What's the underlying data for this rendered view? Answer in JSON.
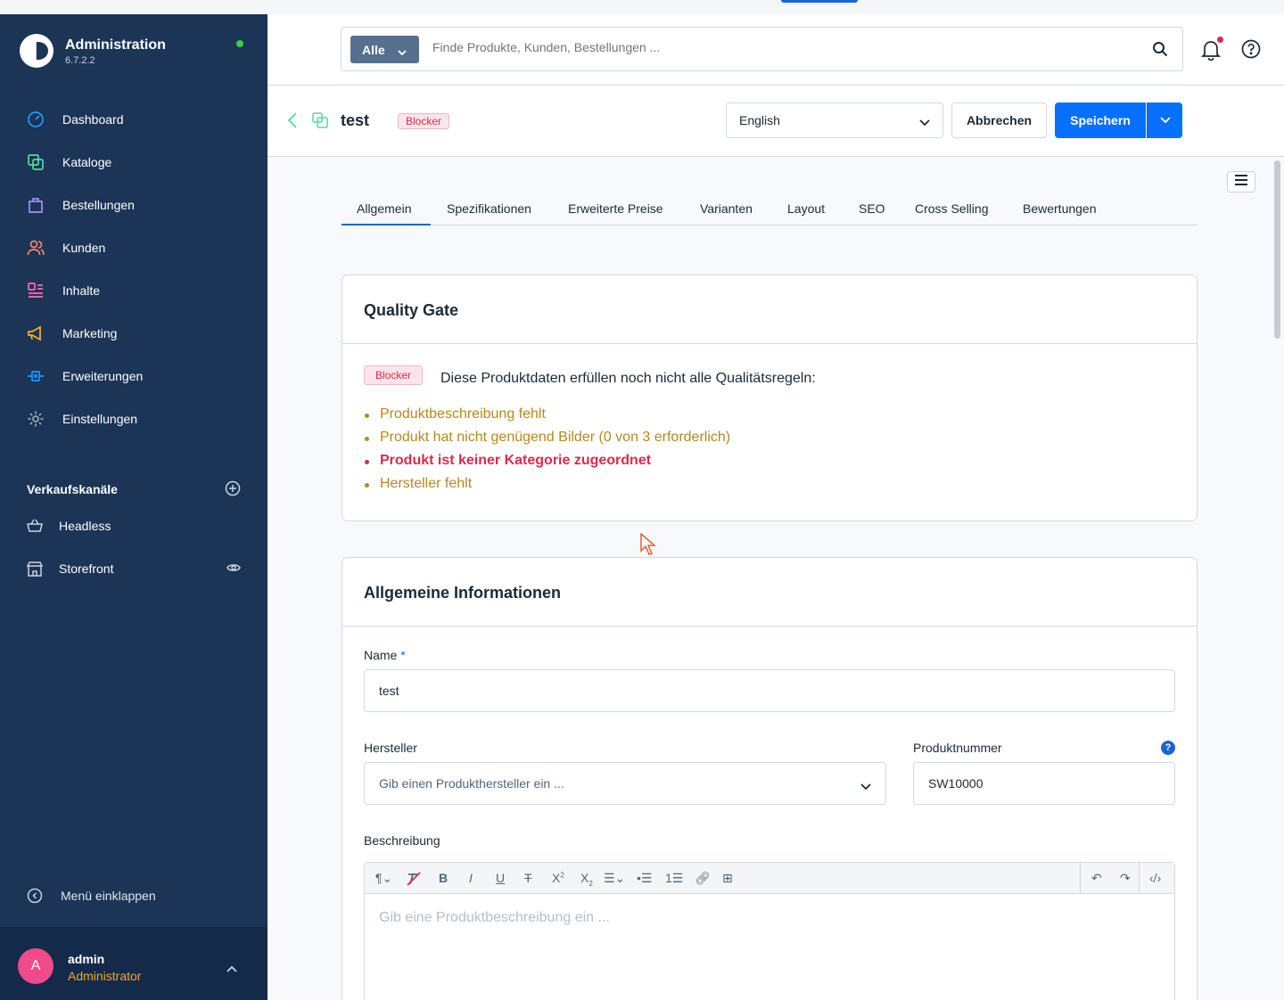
{
  "sidebar": {
    "brand_title": "Administration",
    "brand_version": "6.7.2.2",
    "nav": [
      {
        "label": "Dashboard",
        "icon": "gauge-icon",
        "color": "#189eff"
      },
      {
        "label": "Kataloge",
        "icon": "catalog-icon",
        "color": "#57d9a3"
      },
      {
        "label": "Bestellungen",
        "icon": "shopping-bag-icon",
        "color": "#a092f0"
      },
      {
        "label": "Kunden",
        "icon": "users-icon",
        "color": "#f88962"
      },
      {
        "label": "Inhalte",
        "icon": "content-icon",
        "color": "#ff68b4"
      },
      {
        "label": "Marketing",
        "icon": "megaphone-icon",
        "color": "#ffd700"
      },
      {
        "label": "Erweiterungen",
        "icon": "plug-icon",
        "color": "#189eff"
      },
      {
        "label": "Einstellungen",
        "icon": "gear-icon",
        "color": "#9aa8b5"
      }
    ],
    "sales_channels_title": "Verkaufskanäle",
    "sales_channels": [
      {
        "label": "Headless",
        "icon": "basket-icon"
      },
      {
        "label": "Storefront",
        "icon": "storefront-icon"
      }
    ],
    "collapse_label": "Menü einklappen",
    "user": {
      "initial": "A",
      "name": "admin",
      "role": "Administrator"
    }
  },
  "search": {
    "type_label": "Alle",
    "placeholder": "Finde Produkte, Kunden, Bestellungen ..."
  },
  "header": {
    "title": "test",
    "badge": "Blocker",
    "language": "English",
    "cancel_label": "Abbrechen",
    "save_label": "Speichern"
  },
  "tabs": [
    {
      "label": "Allgemein",
      "active": true
    },
    {
      "label": "Spezifikationen"
    },
    {
      "label": "Erweiterte Preise"
    },
    {
      "label": "Varianten"
    },
    {
      "label": "Layout"
    },
    {
      "label": "SEO"
    },
    {
      "label": "Cross Selling"
    },
    {
      "label": "Bewertungen"
    }
  ],
  "quality_gate": {
    "title": "Quality Gate",
    "badge": "Blocker",
    "message": "Diese Produktdaten erfüllen noch nicht alle Qualitätsregeln:",
    "items": [
      {
        "text": "Produktbeschreibung fehlt",
        "severity": "warning"
      },
      {
        "text": "Produkt hat nicht genügend Bilder (0 von 3 erforderlich)",
        "severity": "warning"
      },
      {
        "text": "Produkt ist keiner Kategorie zugeordnet",
        "severity": "error"
      },
      {
        "text": "Hersteller fehlt",
        "severity": "warning"
      }
    ]
  },
  "general_info": {
    "title": "Allgemeine Informationen",
    "name_label": "Name",
    "name_required": "*",
    "name_value": "test",
    "manufacturer_label": "Hersteller",
    "manufacturer_placeholder": "Gib einen Produkthersteller ein ...",
    "product_number_label": "Produktnummer",
    "product_number_help": "?",
    "product_number_value": "SW10000",
    "description_label": "Beschreibung",
    "description_placeholder": "Gib eine Produktbeschreibung ein ..."
  },
  "colors": {
    "sidebar": "#1c3456",
    "primary": "#0870ff",
    "error": "#de294c",
    "warning": "#b5891d"
  }
}
